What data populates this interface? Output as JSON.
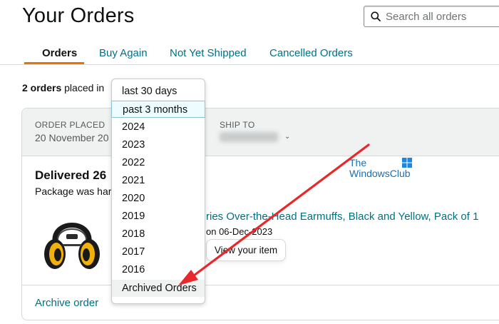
{
  "page": {
    "title": "Your Orders"
  },
  "search": {
    "placeholder": "Search all orders"
  },
  "tabs": [
    {
      "label": "Orders"
    },
    {
      "label": "Buy Again"
    },
    {
      "label": "Not Yet Shipped"
    },
    {
      "label": "Cancelled Orders"
    }
  ],
  "summary": {
    "count_bold": "2 orders",
    "suffix": "placed in"
  },
  "filter_menu": {
    "selected": "past 3 months",
    "options": [
      "last 30 days",
      "past 3 months",
      "2024",
      "2023",
      "2022",
      "2021",
      "2020",
      "2019",
      "2018",
      "2017",
      "2016",
      "Archived Orders"
    ]
  },
  "order": {
    "placed_label": "ORDER PLACED",
    "placed_value": "20 November 20",
    "ship_label": "SHIP TO",
    "delivered": "Delivered 26",
    "package_text": "Package was har",
    "product_title": "ries Over-the-Head Earmuffs, Black and Yellow, Pack of 1",
    "return_text": "on 06-Dec-2023",
    "view_button": "View your item",
    "archive_link": "Archive order"
  },
  "watermark": {
    "line1": "The",
    "line2": "WindowsClub"
  },
  "colors": {
    "link": "#007185",
    "tab_accent": "#e77600",
    "arrow": "#e8282b",
    "header_bg": "#f0f2f2"
  },
  "icons": [
    "search-icon",
    "chevron-down-icon",
    "windows-logo-icon",
    "annotation-arrow"
  ]
}
